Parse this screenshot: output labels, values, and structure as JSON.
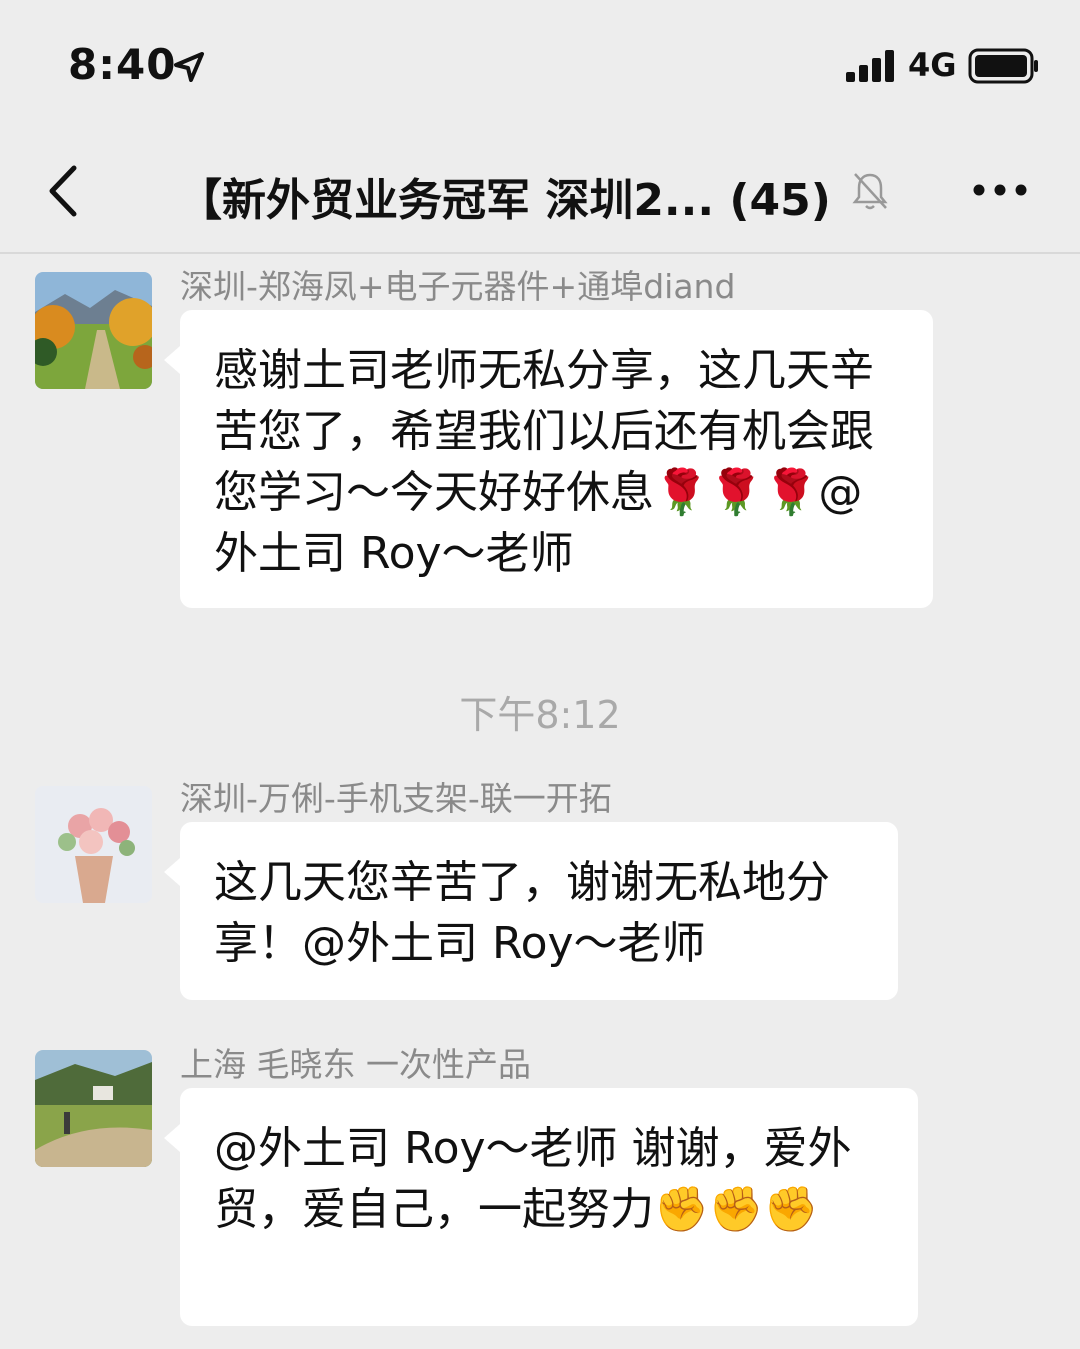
{
  "status_bar": {
    "time": "8:40",
    "network": "4G",
    "icons": [
      "location-arrow-icon",
      "signal-bars-icon",
      "battery-icon"
    ]
  },
  "nav": {
    "title": "【新外贸业务冠军 深圳2... (45)",
    "icons": [
      "back-chevron-icon",
      "muted-bell-icon",
      "more-dots-icon"
    ]
  },
  "messages": [
    {
      "sender": "深圳-郑海凤+电子元器件+通埠diand",
      "text": "感谢土司老师无私分享，这几天辛苦您了，希望我们以后还有机会跟您学习～今天好好休息🌹🌹🌹@外土司 Roy～老师",
      "avatar": "autumn-landscape-avatar"
    },
    {
      "sender": "深圳-万俐-手机支架-联一开拓",
      "text": "这几天您辛苦了，谢谢无私地分享！@外土司 Roy～老师",
      "avatar": "flower-bouquet-avatar"
    },
    {
      "sender": "上海 毛晓东 一次性产品",
      "text": "@外土司 Roy～老师 谢谢，爱外贸，爱自己，一起努力✊✊✊",
      "avatar": "village-path-avatar"
    }
  ],
  "timestamp": "下午8:12"
}
